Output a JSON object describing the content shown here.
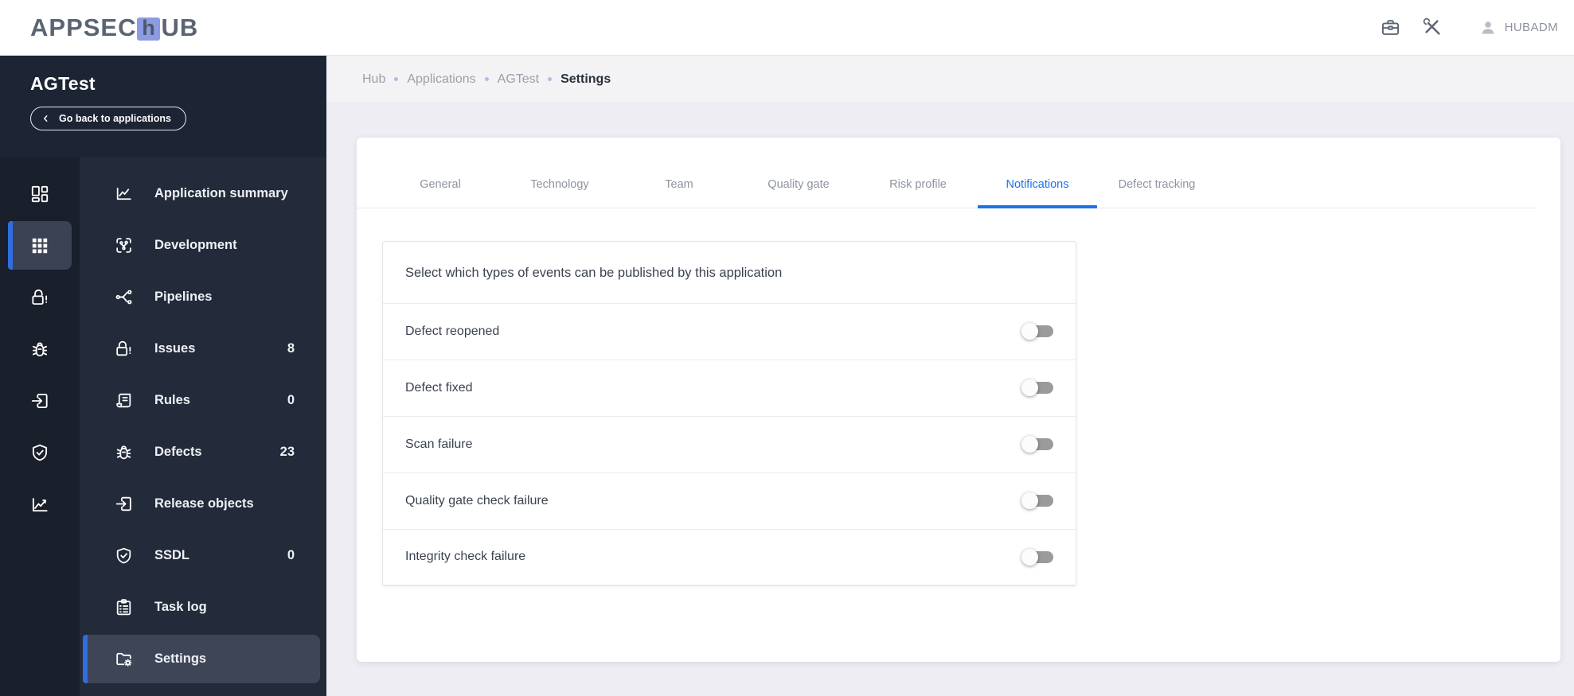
{
  "header": {
    "logo": {
      "prefix": "APPSEC",
      "mid": "h",
      "suffix": "UB"
    },
    "icons": [
      {
        "name": "briefcase-icon"
      },
      {
        "name": "tools-icon"
      }
    ],
    "user": {
      "icon": "user-icon",
      "name": "HUBADM"
    }
  },
  "sidebar": {
    "title": "AGTest",
    "back_button": {
      "icon": "back-chevron-icon",
      "label": "Go back to applications"
    },
    "rail": [
      {
        "icon": "dashboard-icon",
        "active": false
      },
      {
        "icon": "apps-grid-icon",
        "active": true
      },
      {
        "icon": "unlock-alert-icon",
        "active": false
      },
      {
        "icon": "bug-icon",
        "active": false
      },
      {
        "icon": "release-icon",
        "active": false
      },
      {
        "icon": "shield-check-icon",
        "active": false
      },
      {
        "icon": "chart-icon",
        "active": false
      }
    ],
    "menu": [
      {
        "icon": "line-chart-icon",
        "label": "Application summary"
      },
      {
        "icon": "development-icon",
        "label": "Development"
      },
      {
        "icon": "pipelines-icon",
        "label": "Pipelines"
      },
      {
        "icon": "unlock-alert-icon",
        "label": "Issues",
        "badge": "8"
      },
      {
        "icon": "rules-icon",
        "label": "Rules",
        "badge": "0"
      },
      {
        "icon": "bug-icon",
        "label": "Defects",
        "badge": "23"
      },
      {
        "icon": "release-icon",
        "label": "Release objects"
      },
      {
        "icon": "shield-check-icon",
        "label": "SSDL",
        "badge": "0"
      },
      {
        "icon": "task-log-icon",
        "label": "Task log"
      },
      {
        "icon": "settings-folder-icon",
        "label": "Settings",
        "active": true
      }
    ]
  },
  "breadcrumb": [
    "Hub",
    "Applications",
    "AGTest",
    "Settings"
  ],
  "tabs": {
    "items": [
      "General",
      "Technology",
      "Team",
      "Quality gate",
      "Risk profile",
      "Notifications",
      "Defect tracking"
    ],
    "active": "Notifications"
  },
  "notifications_card": {
    "heading": "Select which types of events can be published by this application",
    "toggles": [
      {
        "label": "Defect reopened",
        "enabled": false
      },
      {
        "label": "Defect fixed",
        "enabled": false
      },
      {
        "label": "Scan failure",
        "enabled": false
      },
      {
        "label": "Quality gate check failure",
        "enabled": false
      },
      {
        "label": "Integrity check failure",
        "enabled": false
      }
    ]
  },
  "colors": {
    "accent_blue": "#1a73e8",
    "active_bar_blue": "#2e6ee0",
    "sidebar_header": "#1d2433",
    "rail_bg": "#191f2b",
    "menu_bg": "#232a39",
    "active_item_bg": "#3d4557",
    "logo_square": "#8d9be2",
    "toggle_track_off": "#9b9b9b",
    "main_bg": "#eeedf3"
  }
}
